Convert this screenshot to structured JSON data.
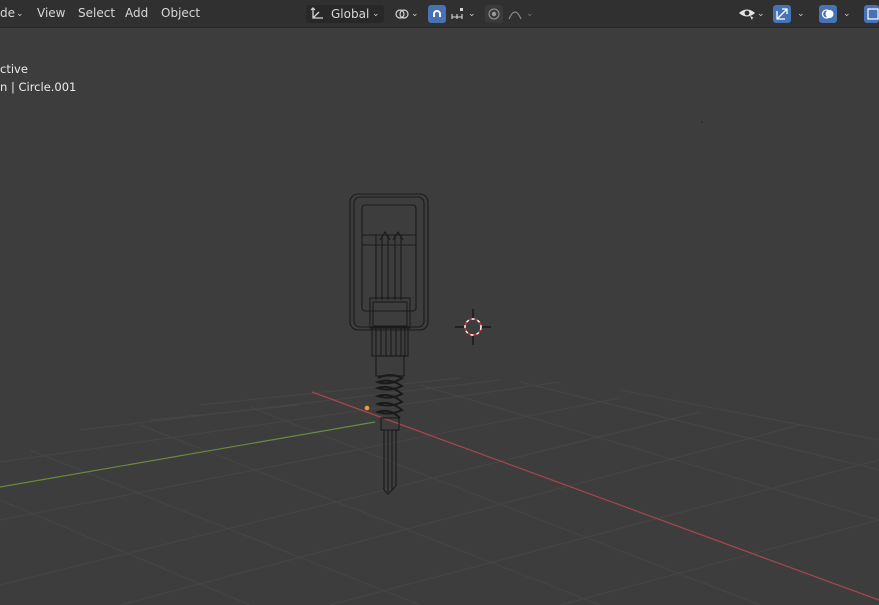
{
  "header": {
    "mode_partial": "de",
    "menus": [
      "View",
      "Select",
      "Add",
      "Object"
    ],
    "transform_orientation": "Global"
  },
  "overlay": {
    "line1": "ctive",
    "line2": "n | Circle.001"
  },
  "icons": {
    "orientation": "transform-orientation-icon",
    "pivot": "pivot-point-icon",
    "snap": "snap-magnet-icon",
    "snap_to": "snap-increment-icon",
    "proportional": "proportional-edit-icon",
    "falloff": "falloff-curve-icon",
    "visibility": "visibility-eye-icon",
    "gizmo": "gizmo-toggle-icon",
    "overlays": "overlays-toggle-icon"
  },
  "colors": {
    "header_bg": "#303030",
    "viewport_bg": "#3d3d3d",
    "accent_blue": "#4772b3",
    "axis_x": "#a8464e",
    "axis_y": "#6d8a3e",
    "origin": "#f29c38"
  }
}
